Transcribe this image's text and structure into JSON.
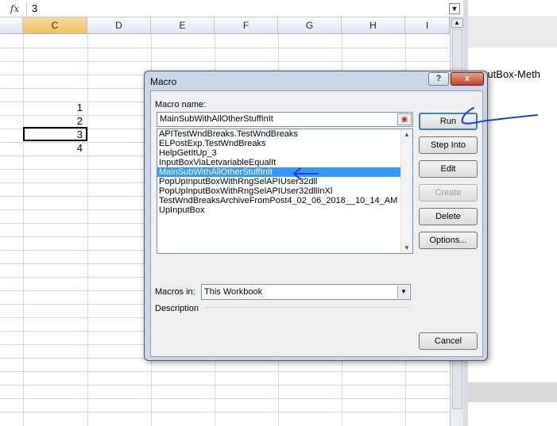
{
  "formula_bar": {
    "fx_label": "fx",
    "value": "3"
  },
  "grid": {
    "columns": [
      "C",
      "D",
      "E",
      "F",
      "G",
      "H",
      "I"
    ],
    "selected_column": "C",
    "cells": [
      {
        "column": "C",
        "value": "1"
      },
      {
        "column": "C",
        "value": "2"
      },
      {
        "column": "C",
        "value": "3"
      },
      {
        "column": "C",
        "value": "4"
      }
    ]
  },
  "right_pane": {
    "text": "nputBox-Meth"
  },
  "dialog": {
    "title": "Macro",
    "help_label": "?",
    "close_label": "x",
    "macro_name_label": "Macro name:",
    "macro_name_value": "MainSubWithAllOtherStuffInIt",
    "macros": [
      "APITestWndBreaks.TestWndBreaks",
      "ELPostExp.TestWndBreaks",
      "HelpGetItUp_3",
      "InputBoxViaLetvariableEqualIt",
      "MainSubWithAllOtherStuffInIt",
      "PopUpInputBoxWithRngSelAPIUser32dll",
      "PopUpInputBoxWithRngSelAPIUser32dllInXl",
      "TestWndBreaksArchiveFromPost4_02_06_2018__10_14_AM",
      "UpInputBox"
    ],
    "selected_macro": "MainSubWithAllOtherStuffInIt",
    "buttons": {
      "run": "Run",
      "step_into": "Step Into",
      "edit": "Edit",
      "create": "Create",
      "delete": "Delete",
      "options": "Options...",
      "cancel": "Cancel"
    },
    "macros_in_label": "Macros in:",
    "macros_in_value": "This Workbook",
    "description_label": "Description"
  },
  "annotation_color": "#1a3fd1"
}
